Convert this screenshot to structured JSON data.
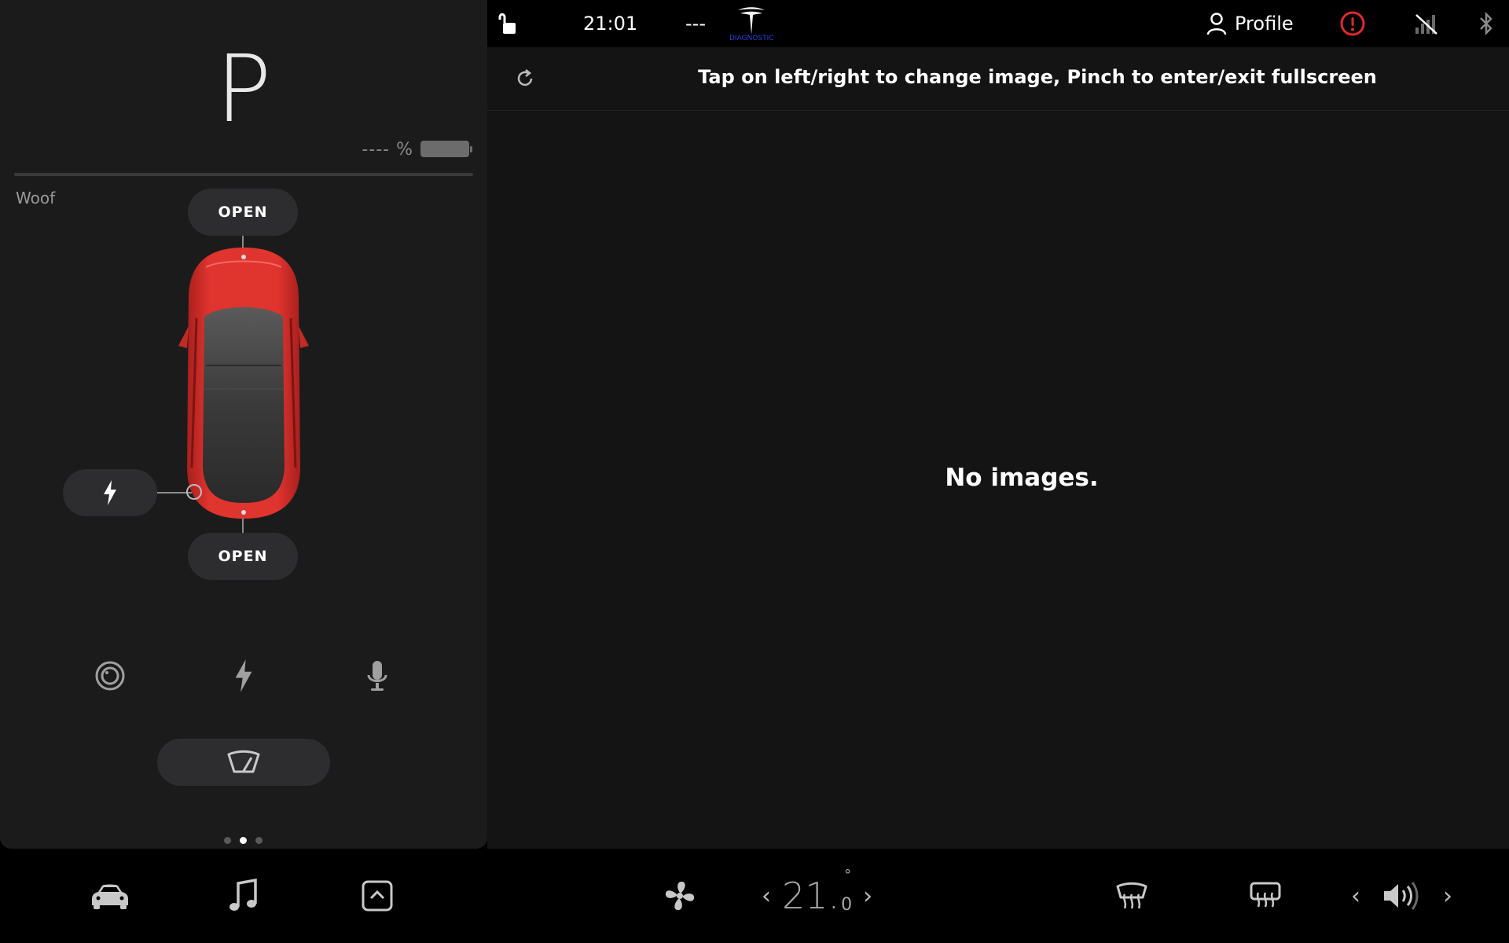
{
  "vehicle": {
    "gear": "P",
    "battery_text": "----",
    "battery_unit": "%",
    "name": "Woof",
    "frunk_label": "OPEN",
    "trunk_label": "OPEN",
    "car_color": "#d9302c"
  },
  "status_bar": {
    "time": "21:01",
    "placeholder": "---",
    "logo_subtitle": "DIAGNOSTIC",
    "profile_label": "Profile",
    "alert_color": "#e0282e"
  },
  "viewer": {
    "instructions": "Tap on left/right to change image, Pinch to enter/exit fullscreen",
    "empty_message": "No images."
  },
  "climate": {
    "temp_whole": "21.",
    "temp_decimal": "0",
    "temp_unit": "°"
  },
  "pager": {
    "count": 3,
    "active_index": 1
  },
  "icons": {
    "quick_controls": [
      "camera-icon",
      "lightning-icon",
      "microphone-icon"
    ],
    "dock": [
      "car-icon",
      "music-icon",
      "app-launcher-icon",
      "fan-icon",
      "rear-defrost-icon",
      "front-defrost-icon",
      "volume-icon"
    ]
  }
}
